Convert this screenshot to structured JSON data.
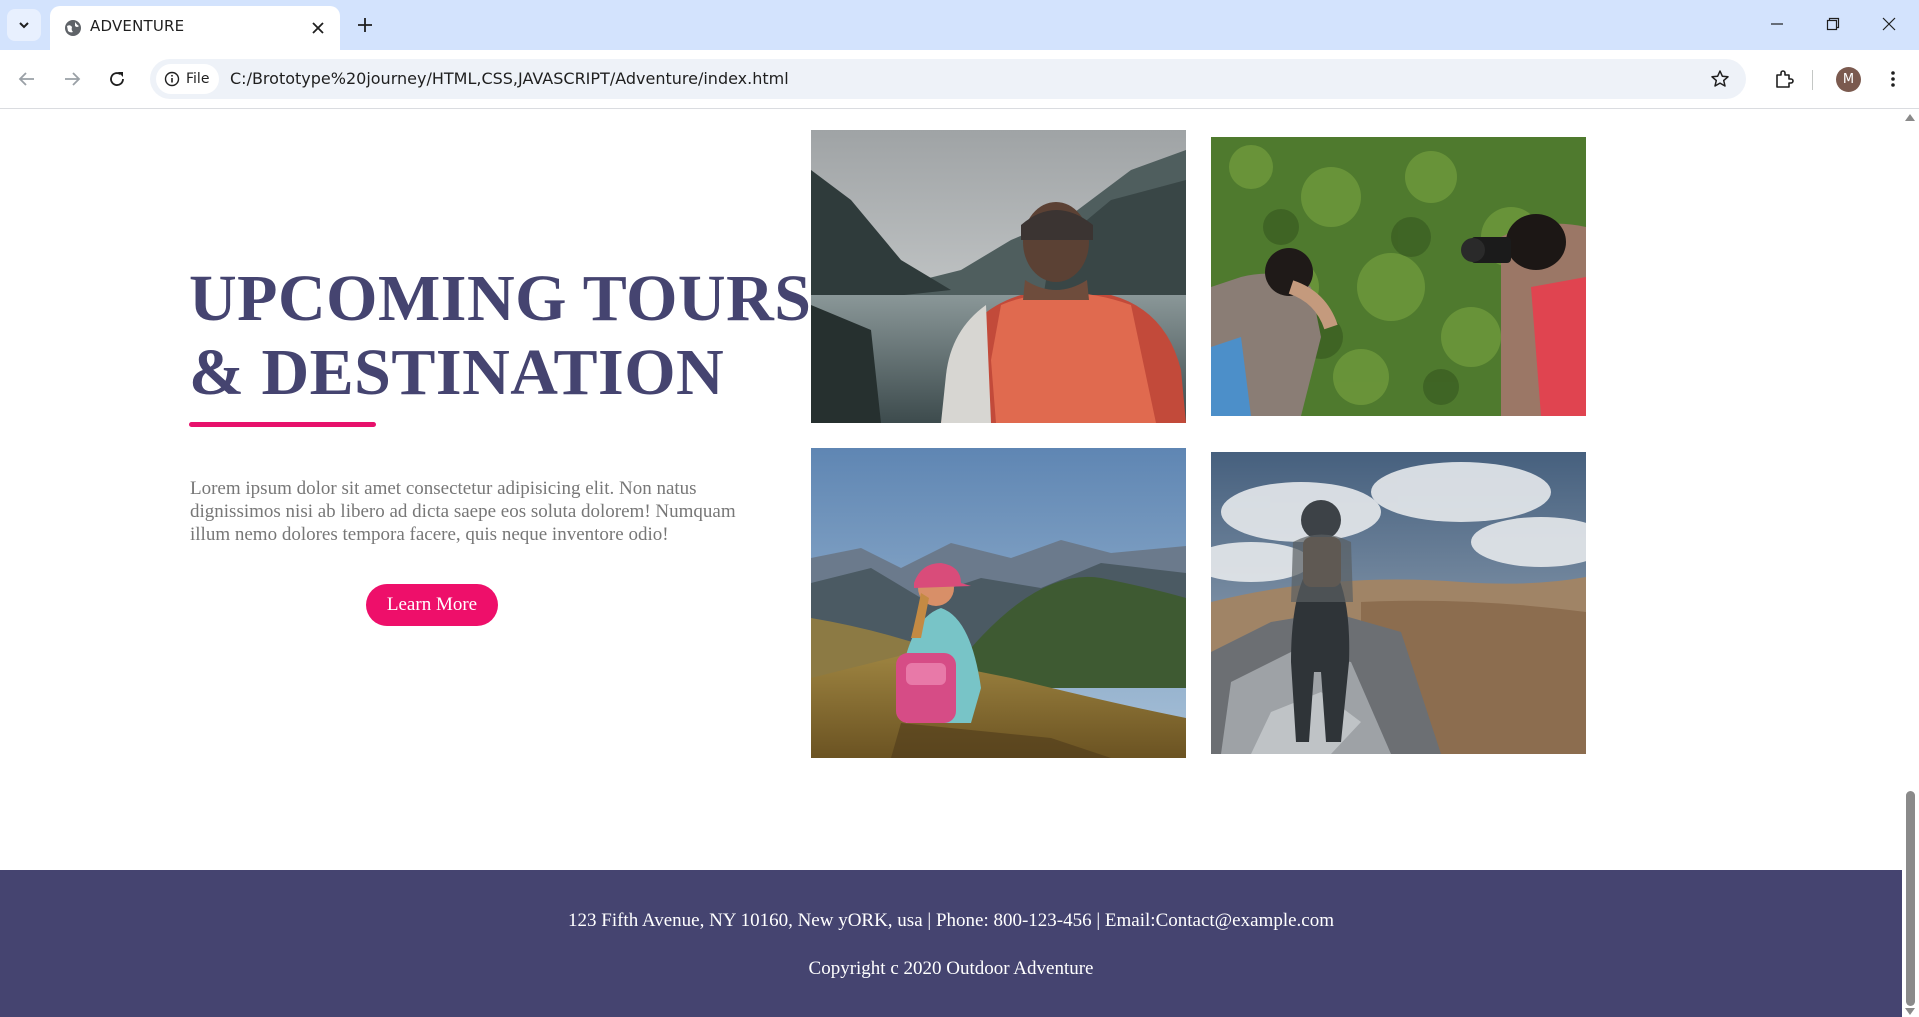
{
  "browser": {
    "tab_title": "ADVENTURE",
    "chip_label": "File",
    "url": "C:/Brototype%20journey/HTML,CSS,JAVASCRIPT/Adventure/index.html",
    "profile_initial": "M"
  },
  "section": {
    "heading_line1": "UPCOMING TOURS",
    "heading_line2": "& DESTINATION",
    "paragraph": "Lorem ipsum dolor sit amet consectetur adipisicing elit. Non natus dignissimos nisi ab libero ad dicta saepe eos soluta dolorem! Numquam illum nemo dolores tempora facere, quis neque inventore odio!",
    "button_label": "Learn More"
  },
  "gallery": [
    {
      "name": "lake-hiker-photo"
    },
    {
      "name": "photographers-photo"
    },
    {
      "name": "girl-mountains-photo"
    },
    {
      "name": "rocky-trail-photo"
    }
  ],
  "footer": {
    "contact": "123 Fifth Avenue, NY 10160, New yORK, usa | Phone: 800-123-456 | Email:Contact@example.com",
    "copyright": "Copyright c 2020 Outdoor Adventure"
  },
  "colors": {
    "heading": "#454470",
    "accent": "#e7116b",
    "footer_bg": "#454470",
    "tabbar_bg": "#d3e3fd"
  }
}
